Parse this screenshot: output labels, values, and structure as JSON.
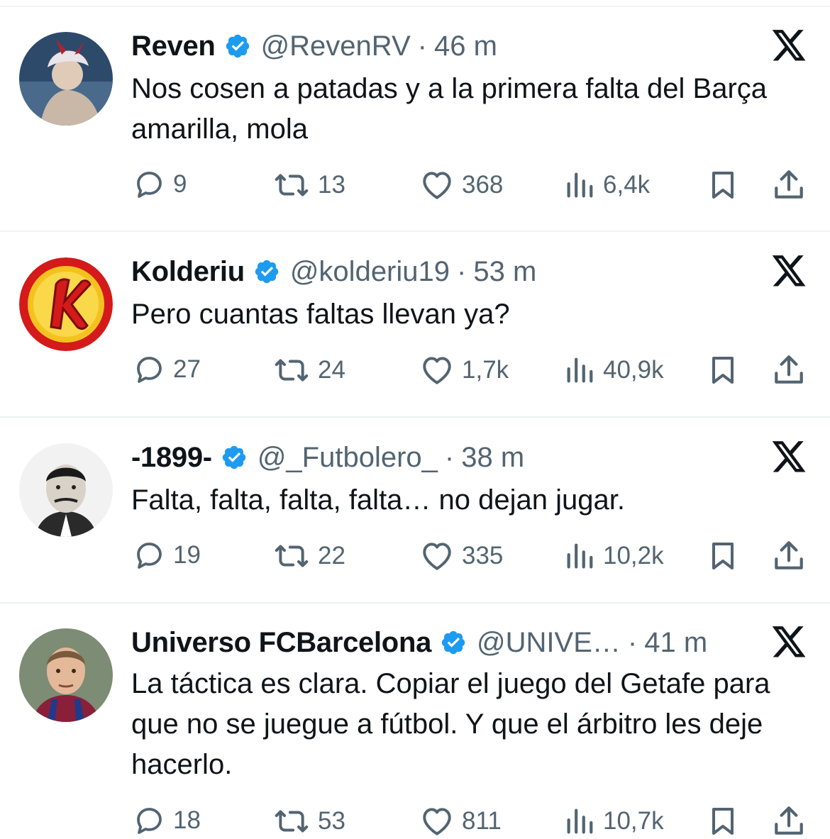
{
  "tweets": [
    {
      "name": "Reven",
      "handle": "@RevenRV",
      "time": "46 m",
      "text": "Nos cosen a patadas y a la primera falta del Barça amarilla, mola",
      "replies": "9",
      "reposts": "13",
      "likes": "368",
      "views": "6,4k"
    },
    {
      "name": "Kolderiu",
      "handle": "@kolderiu19",
      "time": "53 m",
      "text": "Pero cuantas faltas llevan ya?",
      "replies": "27",
      "reposts": "24",
      "likes": "1,7k",
      "views": "40,9k"
    },
    {
      "name": "-1899-",
      "handle": "@_Futbolero_",
      "time": "38 m",
      "text": "Falta, falta, falta, falta… no dejan jugar.",
      "replies": "19",
      "reposts": "22",
      "likes": "335",
      "views": "10,2k"
    },
    {
      "name": "Universo FCBarcelona",
      "handle": "@UNIVE…",
      "time": "41 m",
      "text": "La táctica es clara. Copiar el juego del Getafe para que no se juegue a fútbol. Y que el árbitro les deje hacerlo.",
      "replies": "18",
      "reposts": "53",
      "likes": "811",
      "views": "10,7k"
    }
  ],
  "separator": "·",
  "icons": {
    "verified": "verified-badge-icon",
    "more": "x-logo-icon",
    "reply": "reply-icon",
    "repost": "repost-icon",
    "like": "heart-icon",
    "views": "views-icon",
    "bookmark": "bookmark-icon",
    "share": "share-icon"
  },
  "colors": {
    "verified": "#1d9bf0",
    "text": "#0f1419",
    "secondary": "#536471",
    "divider": "#eff3f4"
  }
}
